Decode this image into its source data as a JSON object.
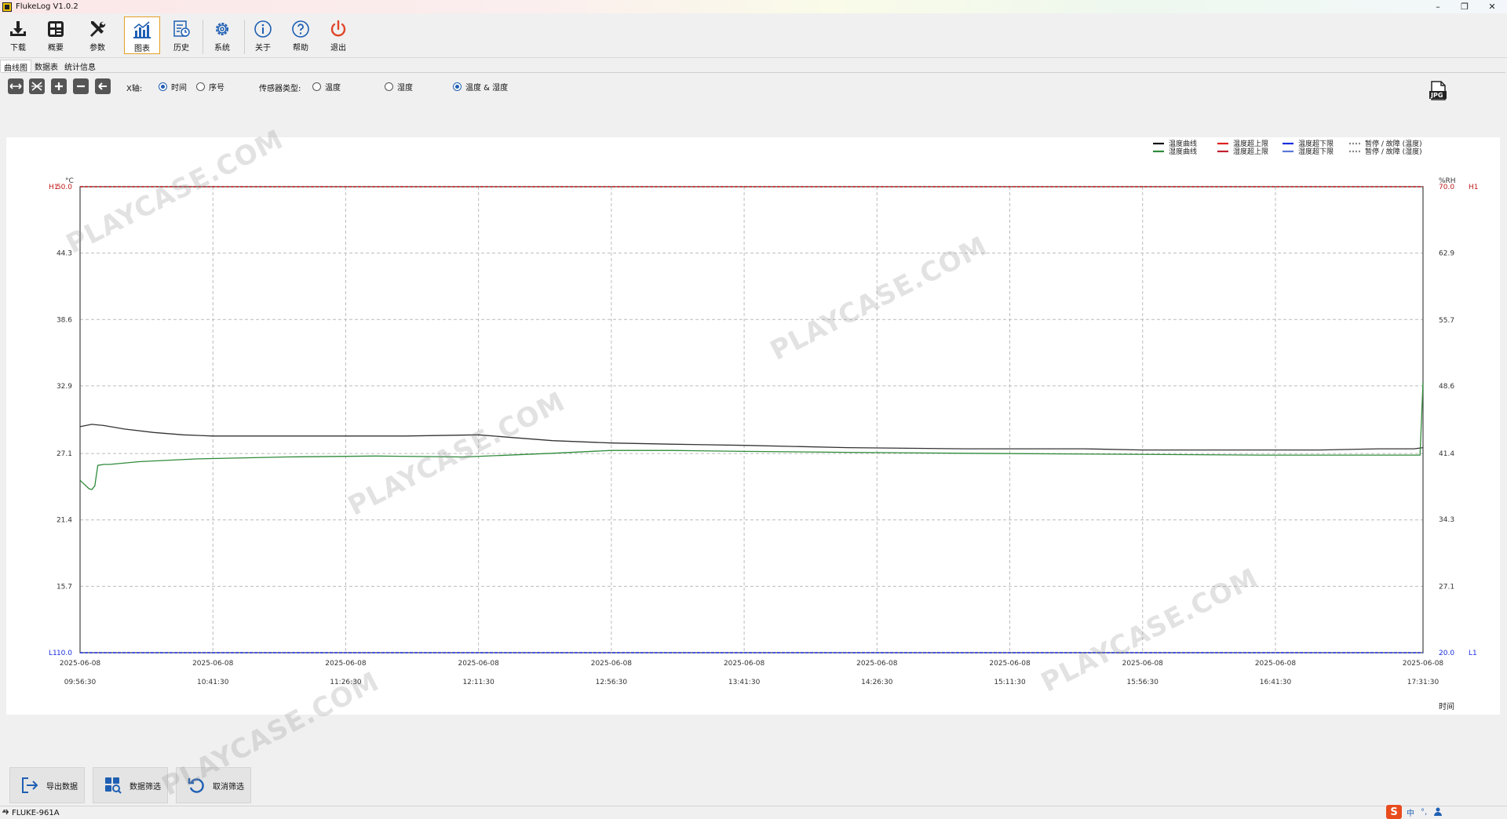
{
  "window": {
    "title": "FlukeLog V1.0.2",
    "minimize": "–",
    "maximize": "❐",
    "close": "✕"
  },
  "toolbar": {
    "items": [
      {
        "label": "下载",
        "icon": "download-icon"
      },
      {
        "label": "概要",
        "icon": "summary-icon"
      },
      {
        "label": "参数",
        "icon": "tools-icon"
      },
      {
        "label": "图表",
        "icon": "chart-icon",
        "active": true
      },
      {
        "label": "历史",
        "icon": "history-icon"
      },
      {
        "label": "系统",
        "icon": "gear-icon"
      },
      {
        "label": "关于",
        "icon": "info-icon"
      },
      {
        "label": "帮助",
        "icon": "help-icon"
      },
      {
        "label": "退出",
        "icon": "power-icon"
      }
    ]
  },
  "tabs": [
    {
      "label": "曲线图",
      "active": true
    },
    {
      "label": "数据表"
    },
    {
      "label": "统计信息"
    }
  ],
  "controls": {
    "zoom_buttons": [
      "fit-horizontal-icon",
      "fit-all-icon",
      "zoom-in-icon",
      "zoom-out-icon",
      "back-icon"
    ],
    "xaxis_label": "X轴:",
    "xaxis_options": [
      {
        "label": "时间",
        "checked": true
      },
      {
        "label": "序号",
        "checked": false
      }
    ],
    "sensor_label": "传感器类型:",
    "sensor_options": [
      {
        "label": "温度",
        "checked": false
      },
      {
        "label": "湿度",
        "checked": false
      },
      {
        "label": "温度 & 湿度",
        "checked": true
      }
    ],
    "jpg_label": "JPG"
  },
  "chart_data": {
    "type": "line",
    "left_unit": "°C",
    "right_unit": "%RH",
    "xlabel": "时间",
    "left_ylim": [
      10.0,
      50.0
    ],
    "right_ylim": [
      20.0,
      70.0
    ],
    "left_ticks": [
      "10.0",
      "15.7",
      "21.4",
      "27.1",
      "32.9",
      "38.6",
      "44.3",
      "50.0"
    ],
    "right_ticks": [
      "20.0",
      "27.1",
      "34.3",
      "41.4",
      "48.6",
      "55.7",
      "62.9",
      "70.0"
    ],
    "high_limit_label": "H1",
    "low_limit_label": "L1",
    "x_date": "2025-06-08",
    "x_times": [
      "09:56:30",
      "10:41:30",
      "11:26:30",
      "12:11:30",
      "12:56:30",
      "13:41:30",
      "14:26:30",
      "15:11:30",
      "15:56:30",
      "16:41:30",
      "17:31:30"
    ],
    "x_tick_positions_min": [
      0,
      45,
      90,
      135,
      180,
      225,
      270,
      315,
      360,
      405,
      455
    ],
    "x_range_min": [
      0,
      455
    ],
    "grid": true,
    "legend_position": "top-right",
    "legend": [
      {
        "name": "温度曲线",
        "color": "#111111",
        "style": "solid"
      },
      {
        "name": "湿度曲线",
        "color": "#2e8b3a",
        "style": "solid"
      },
      {
        "name": "温度超上限",
        "color": "#e02020",
        "style": "solid"
      },
      {
        "name": "湿度超上限",
        "color": "#c02030",
        "style": "solid"
      },
      {
        "name": "温度超下限",
        "color": "#1a2ee0",
        "style": "solid"
      },
      {
        "name": "湿度超下限",
        "color": "#5a78d8",
        "style": "solid"
      },
      {
        "name": "暂停 / 故障 (温度)",
        "color": "#888888",
        "style": "dotted"
      },
      {
        "name": "暂停 / 故障 (湿度)",
        "color": "#888888",
        "style": "dotted"
      }
    ],
    "series": [
      {
        "name": "温度曲线",
        "axis": "left",
        "color": "#333333",
        "x": [
          0,
          4,
          8,
          15,
          25,
          35,
          45,
          60,
          90,
          110,
          135,
          145,
          160,
          180,
          200,
          225,
          260,
          300,
          340,
          360,
          380,
          400,
          420,
          440,
          452,
          455
        ],
        "y": [
          29.4,
          29.6,
          29.5,
          29.2,
          28.9,
          28.7,
          28.6,
          28.6,
          28.6,
          28.6,
          28.7,
          28.5,
          28.2,
          28.0,
          27.9,
          27.8,
          27.6,
          27.5,
          27.5,
          27.4,
          27.4,
          27.4,
          27.4,
          27.5,
          27.5,
          27.6
        ]
      },
      {
        "name": "湿度曲线",
        "axis": "right",
        "color": "#2e8b3a",
        "x": [
          0,
          1,
          3,
          4,
          5,
          6,
          8,
          10,
          20,
          40,
          70,
          100,
          130,
          160,
          180,
          200,
          225,
          260,
          300,
          350,
          400,
          420,
          440,
          454,
          455
        ],
        "y": [
          38.5,
          38.2,
          37.6,
          37.5,
          37.9,
          40.1,
          40.2,
          40.2,
          40.5,
          40.8,
          41.0,
          41.1,
          41.0,
          41.4,
          41.7,
          41.7,
          41.6,
          41.5,
          41.4,
          41.3,
          41.2,
          41.2,
          41.2,
          41.2,
          49.0
        ]
      },
      {
        "name": "温度超上限",
        "axis": "left",
        "color": "#c01818",
        "style": "dashed",
        "x": [
          0,
          455
        ],
        "y": [
          50.0,
          50.0
        ]
      },
      {
        "name": "温度超下限",
        "axis": "left",
        "color": "#1a2ee0",
        "style": "dashed",
        "x": [
          0,
          455
        ],
        "y": [
          10.0,
          10.0
        ]
      }
    ]
  },
  "bottom_buttons": [
    {
      "label": "导出数据",
      "icon": "export-icon"
    },
    {
      "label": "数据筛选",
      "icon": "filter-icon"
    },
    {
      "label": "取消筛选",
      "icon": "undo-icon"
    }
  ],
  "status": {
    "device": "FLUKE-961A",
    "usb_icon": "usb-icon",
    "tray_lang": "中"
  },
  "watermark": "PLAYCASE.COM"
}
